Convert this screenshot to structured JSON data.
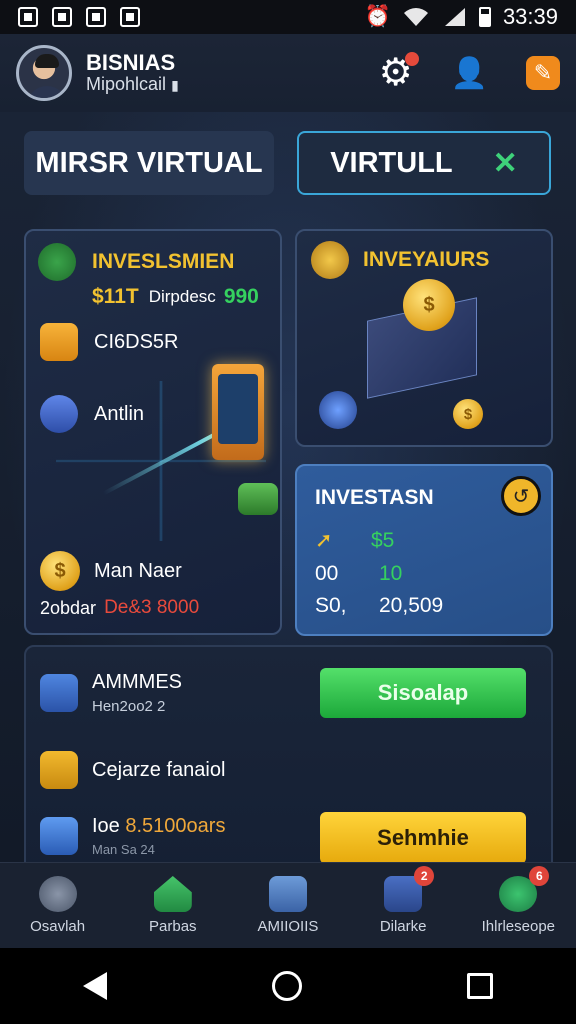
{
  "status_bar": {
    "time": "33:39"
  },
  "header": {
    "user_name": "BISNIAS",
    "user_sub": "Mipohlcail"
  },
  "tabs": {
    "left": "MIRSR VIRTUAL",
    "right": "VIRTULL"
  },
  "card_invest": {
    "title": "INVESLSMIEN",
    "value_prefix": "$11T",
    "value_mid": "Dirpdesc",
    "value_green": "990",
    "item2": "CI6DS5R",
    "item3": "Antlin",
    "item4": "Man Naer",
    "footer_label": "2obdar",
    "footer_value": "De&3 8000"
  },
  "card_invest2": {
    "title": "INVEYAIURS"
  },
  "card_investasi": {
    "title": "INVESTASN",
    "rows": [
      {
        "label": "",
        "value": "$5"
      },
      {
        "label": "00",
        "value": "10"
      },
      {
        "label": "S0,",
        "value": "20,509"
      }
    ]
  },
  "card_bottom": {
    "row1_title": "AMMMES",
    "row1_sub": "Hen2oo2 2",
    "row2_title": "Cejarze fanaiol",
    "row3_prefix": "Ioe",
    "row3_value": "8.5100oars",
    "row3_sub": "Man Sa 24",
    "btn_green": "Sisoalap",
    "btn_yellow": "Sehmhie"
  },
  "bottom_nav": [
    {
      "label": "Osavlah",
      "badge": ""
    },
    {
      "label": "Parbas",
      "badge": ""
    },
    {
      "label": "AMIIOIIS",
      "badge": ""
    },
    {
      "label": "Dilarke",
      "badge": "2"
    },
    {
      "label": "Ihlrleseope",
      "badge": "6"
    }
  ],
  "colors": {
    "accent_green": "#35d15f",
    "accent_yellow": "#f2c230",
    "accent_red": "#e84a3c",
    "accent_blue": "#3aa6d8"
  }
}
